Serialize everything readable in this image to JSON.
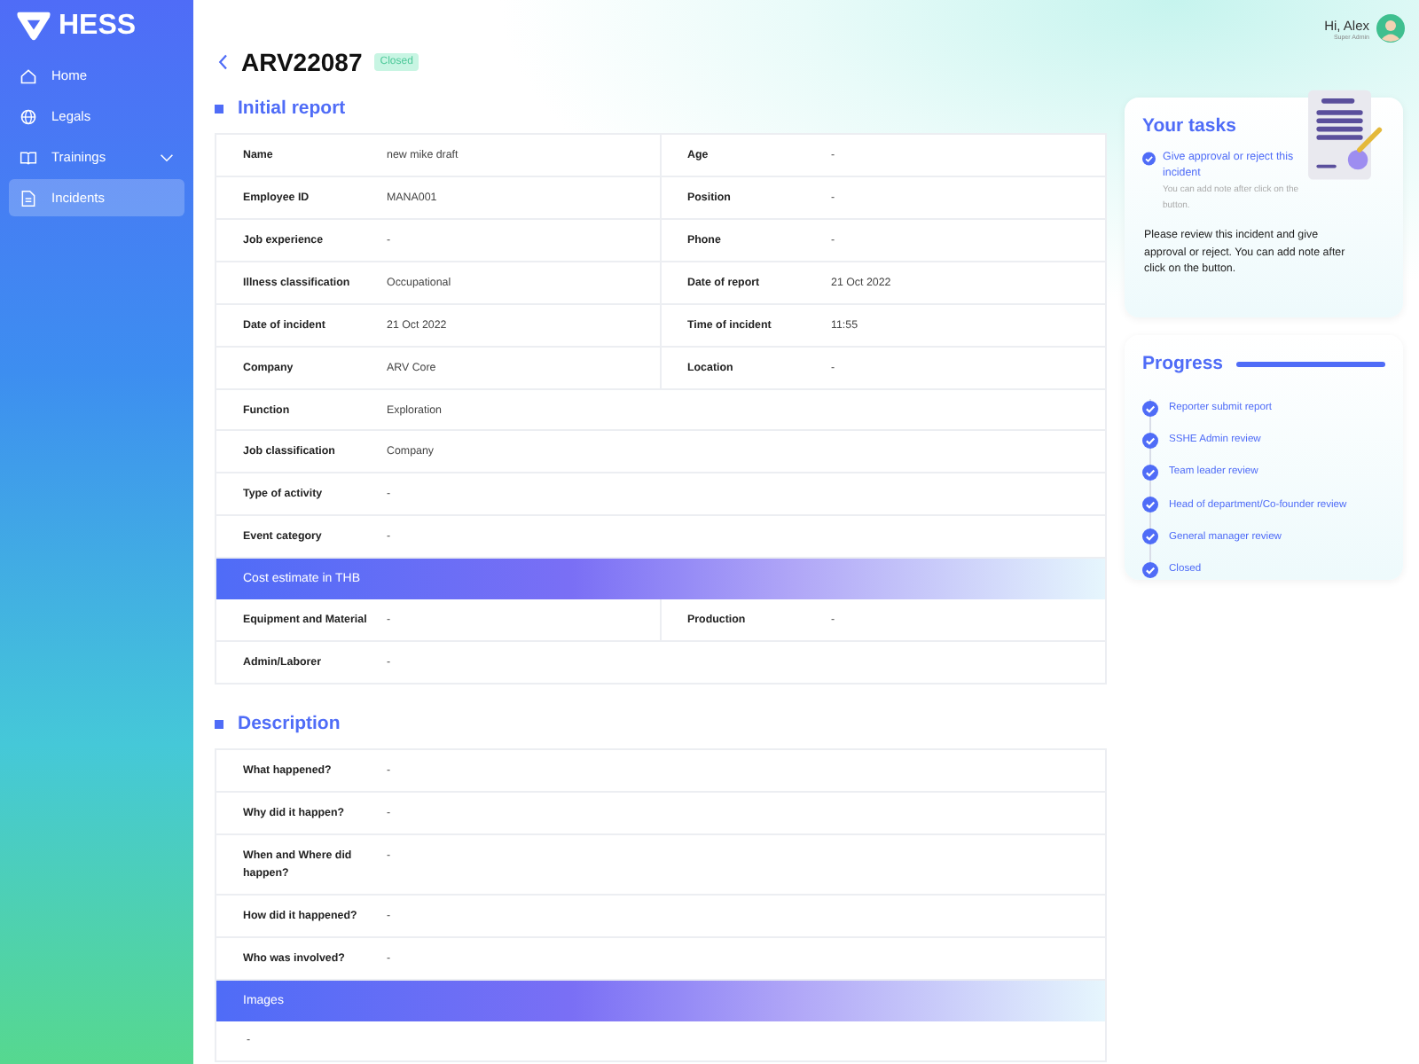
{
  "brand": {
    "name": "HESS"
  },
  "sidebar": {
    "items": [
      {
        "label": "Home",
        "selected": false
      },
      {
        "label": "Legals",
        "selected": false
      },
      {
        "label": "Trainings",
        "selected": false,
        "expanded": false
      },
      {
        "label": "Incidents",
        "selected": true
      }
    ]
  },
  "header": {
    "title": "ARV22087",
    "status": "Closed"
  },
  "user": {
    "greeting": "Hi, Alex",
    "role": "Super Admin"
  },
  "initial_report": {
    "title": "Initial report",
    "rows": [
      {
        "kind": "fields",
        "cells": [
          {
            "label": "Name",
            "value": "new mike draft"
          },
          {
            "label": "Age",
            "value": "-"
          }
        ]
      },
      {
        "kind": "fields",
        "cells": [
          {
            "label": "Employee ID",
            "value": "MANA001"
          },
          {
            "label": "Position",
            "value": "-"
          }
        ]
      },
      {
        "kind": "fields",
        "cells": [
          {
            "label": "Job experience",
            "value": "-"
          },
          {
            "label": "Phone",
            "value": "-"
          }
        ]
      },
      {
        "kind": "fields",
        "cells": [
          {
            "label": "Illness classification",
            "value": "Occupational"
          },
          {
            "label": "Date of report",
            "value": "21 Oct 2022"
          }
        ]
      },
      {
        "kind": "fields",
        "cells": [
          {
            "label": "Date of incident",
            "value": "21 Oct 2022"
          },
          {
            "label": "Time of incident",
            "value": "11:55"
          }
        ]
      },
      {
        "kind": "fields",
        "cells": [
          {
            "label": "Company",
            "value": "ARV Core"
          },
          {
            "label": "Location",
            "value": "-"
          }
        ]
      },
      {
        "kind": "fields",
        "cells": [
          {
            "label": "Function",
            "value": "Exploration"
          }
        ]
      },
      {
        "kind": "fields",
        "cells": [
          {
            "label": "Job classification",
            "value": "Company"
          }
        ]
      },
      {
        "kind": "fields",
        "cells": [
          {
            "label": "Type of activity",
            "value": "-"
          }
        ]
      },
      {
        "kind": "fields",
        "cells": [
          {
            "label": "Event category",
            "value": "-"
          }
        ]
      },
      {
        "kind": "band",
        "text": "Cost estimate in THB"
      },
      {
        "kind": "fields",
        "cells": [
          {
            "label": "Equipment and Material",
            "value": "-"
          },
          {
            "label": "Production",
            "value": "-"
          }
        ]
      },
      {
        "kind": "fields",
        "cells": [
          {
            "label": "Admin/Laborer",
            "value": "-"
          }
        ]
      }
    ]
  },
  "description": {
    "title": "Description",
    "rows": [
      {
        "kind": "fields",
        "cells": [
          {
            "label": "What happened?",
            "value": "-"
          }
        ]
      },
      {
        "kind": "fields",
        "cells": [
          {
            "label": "Why did it happen?",
            "value": "-"
          }
        ]
      },
      {
        "kind": "fields",
        "cells": [
          {
            "label": "When and Where did happen?",
            "value": "-"
          }
        ]
      },
      {
        "kind": "fields",
        "cells": [
          {
            "label": "How did it happened?",
            "value": "-"
          }
        ]
      },
      {
        "kind": "fields",
        "cells": [
          {
            "label": "Who was involved?",
            "value": "-"
          }
        ]
      },
      {
        "kind": "band",
        "text": "Images"
      },
      {
        "kind": "plain",
        "text": "-"
      }
    ]
  },
  "tasks": {
    "title": "Your tasks",
    "items": [
      {
        "title": "Give approval or reject this incident",
        "note": "You can add note after click on the button.",
        "done": true
      }
    ],
    "text": "Please review this incident and give approval or reject. You can add note after click on the button."
  },
  "progress": {
    "title": "Progress",
    "steps": [
      {
        "label": "Reporter submit report",
        "done": true
      },
      {
        "label": "SSHE Admin review",
        "done": true
      },
      {
        "label": "Team leader review",
        "done": true
      },
      {
        "label": "Head of department/Co-founder review",
        "done": true
      },
      {
        "label": "General manager review",
        "done": true
      },
      {
        "label": "Closed",
        "done": true
      }
    ]
  }
}
